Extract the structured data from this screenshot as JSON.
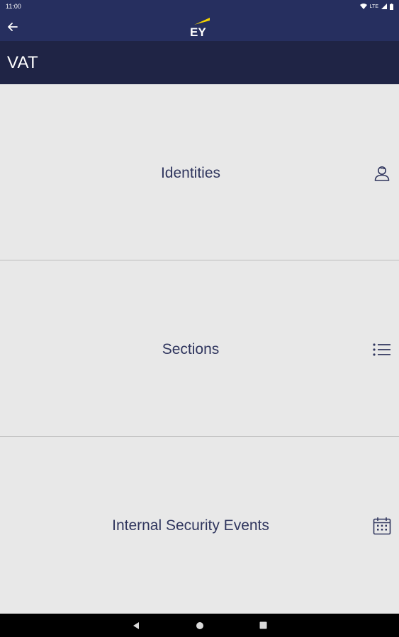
{
  "status_bar": {
    "time": "11:00",
    "network": "LTE",
    "icons": [
      "wifi-icon",
      "signal-icon",
      "battery-icon"
    ]
  },
  "header": {
    "back_icon": "back-arrow-icon",
    "logo_text": "EY"
  },
  "title": "VAT",
  "menu": {
    "items": [
      {
        "label": "Identities",
        "icon": "person-icon"
      },
      {
        "label": "Sections",
        "icon": "list-icon"
      },
      {
        "label": "Internal Security Events",
        "icon": "calendar-icon"
      }
    ]
  },
  "navigation_bar": {
    "buttons": [
      "back-triangle-icon",
      "home-circle-icon",
      "recents-square-icon"
    ]
  },
  "colors": {
    "header_bg": "#262f5f",
    "title_bg": "#1f2445",
    "content_bg": "#e8e8e8",
    "accent_yellow": "#f5d300",
    "text_navy": "#30365e"
  }
}
